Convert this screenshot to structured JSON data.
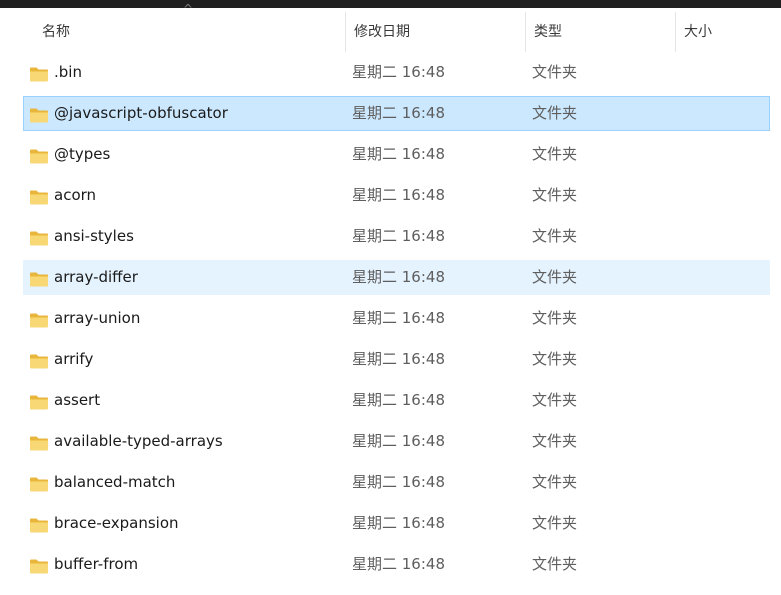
{
  "columns": {
    "name": "名称",
    "modified": "修改日期",
    "type": "类型",
    "size": "大小"
  },
  "sort_indicator": "^",
  "rows": [
    {
      "name": ".bin",
      "modified": "星期二 16:48",
      "type": "文件夹",
      "size": ""
    },
    {
      "name": "@javascript-obfuscator",
      "modified": "星期二 16:48",
      "type": "文件夹",
      "size": ""
    },
    {
      "name": "@types",
      "modified": "星期二 16:48",
      "type": "文件夹",
      "size": ""
    },
    {
      "name": "acorn",
      "modified": "星期二 16:48",
      "type": "文件夹",
      "size": ""
    },
    {
      "name": "ansi-styles",
      "modified": "星期二 16:48",
      "type": "文件夹",
      "size": ""
    },
    {
      "name": "array-differ",
      "modified": "星期二 16:48",
      "type": "文件夹",
      "size": ""
    },
    {
      "name": "array-union",
      "modified": "星期二 16:48",
      "type": "文件夹",
      "size": ""
    },
    {
      "name": "arrify",
      "modified": "星期二 16:48",
      "type": "文件夹",
      "size": ""
    },
    {
      "name": "assert",
      "modified": "星期二 16:48",
      "type": "文件夹",
      "size": ""
    },
    {
      "name": "available-typed-arrays",
      "modified": "星期二 16:48",
      "type": "文件夹",
      "size": ""
    },
    {
      "name": "balanced-match",
      "modified": "星期二 16:48",
      "type": "文件夹",
      "size": ""
    },
    {
      "name": "brace-expansion",
      "modified": "星期二 16:48",
      "type": "文件夹",
      "size": ""
    },
    {
      "name": "buffer-from",
      "modified": "星期二 16:48",
      "type": "文件夹",
      "size": ""
    }
  ],
  "selected_row": "@javascript-obfuscator",
  "hovered_row": "array-differ",
  "icons": {
    "folder": "folder-icon"
  },
  "colors": {
    "selected_bg": "#cce8ff",
    "selected_border": "#99d1ff",
    "hover_bg": "#e5f3ff",
    "folder_body": "#f8d775",
    "folder_tab": "#e8b53d"
  }
}
